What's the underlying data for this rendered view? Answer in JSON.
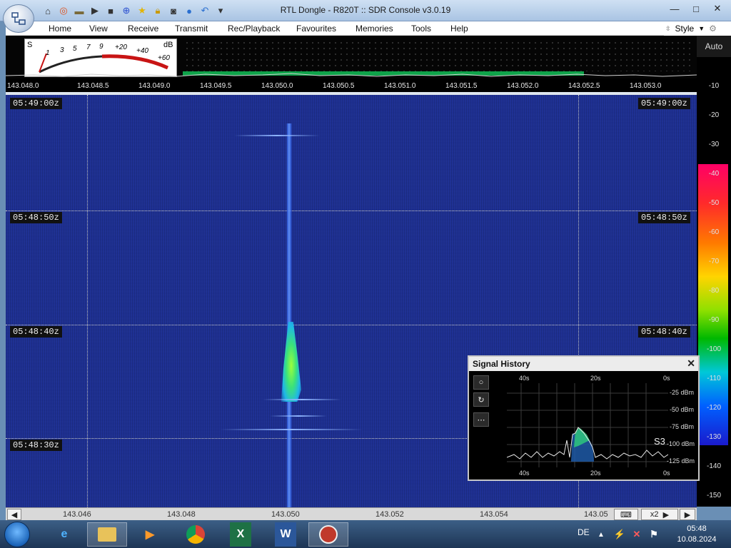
{
  "window": {
    "title": "RTL Dongle - R820T :: SDR Console v3.0.19",
    "controls": [
      "minimize",
      "maximize",
      "close"
    ]
  },
  "quick_access": [
    "home-icon",
    "lifebuoy-icon",
    "folder-icon",
    "play-icon",
    "stop-icon",
    "plus-icon",
    "star-icon",
    "lock-icon",
    "camera-icon",
    "drop-icon",
    "undo-icon",
    "dropdown-icon"
  ],
  "menu": [
    "Home",
    "View",
    "Receive",
    "Transmit",
    "Rec/Playback",
    "Favourites",
    "Memories",
    "Tools",
    "Help"
  ],
  "style_menu": {
    "label": "Style"
  },
  "smeter": {
    "s_label": "S",
    "db_label": "dB",
    "scale_s": [
      "1",
      "3",
      "5",
      "7",
      "9"
    ],
    "scale_db": [
      "+20",
      "+40",
      "+60"
    ]
  },
  "auto_button": "Auto",
  "freq_scale": [
    "143.048.0",
    "143.048.5",
    "143.049.0",
    "143.049.5",
    "143.050.0",
    "143.050.5",
    "143.051.0",
    "143.051.5",
    "143.052.0",
    "143.052.5",
    "143.053.0"
  ],
  "db_scale": [
    "-10",
    "-20",
    "-30",
    "-40",
    "-50",
    "-60",
    "-70",
    "-80",
    "-90",
    "-100",
    "-110",
    "-120",
    "-130",
    "-140",
    "-150"
  ],
  "waterfall": {
    "timestamps": [
      "05:49:00z",
      "05:48:50z",
      "05:48:40z",
      "05:48:30z"
    ]
  },
  "bottom_scale": [
    "143.046",
    "143.048",
    "143.050",
    "143.052",
    "143.054",
    "143.05"
  ],
  "bottom_controls": {
    "zoom": "x2"
  },
  "signal_history": {
    "title": "Signal History",
    "time_top": [
      "40s",
      "20s",
      "0s"
    ],
    "time_bottom": [
      "40s",
      "20s",
      "0s"
    ],
    "dbm_labels": [
      "-25 dBm",
      "-50 dBm",
      "-75 dBm",
      "-100 dBm",
      "-125 dBm"
    ],
    "s_reading": "S3",
    "tools": [
      "record-icon",
      "reset-icon",
      "more-icon"
    ]
  },
  "taskbar": {
    "apps": [
      "internet-explorer-icon",
      "file-explorer-icon",
      "media-player-icon",
      "chrome-icon",
      "excel-icon",
      "word-icon",
      "sdr-console-icon"
    ],
    "language": "DE",
    "time": "05:48",
    "date": "10.08.2024"
  },
  "colors": {
    "waterfall_bg": "#1c2e8e",
    "signal_peak": "#9cff3c",
    "green_band": "#0fa34a",
    "smeter_red": "#c81414"
  }
}
